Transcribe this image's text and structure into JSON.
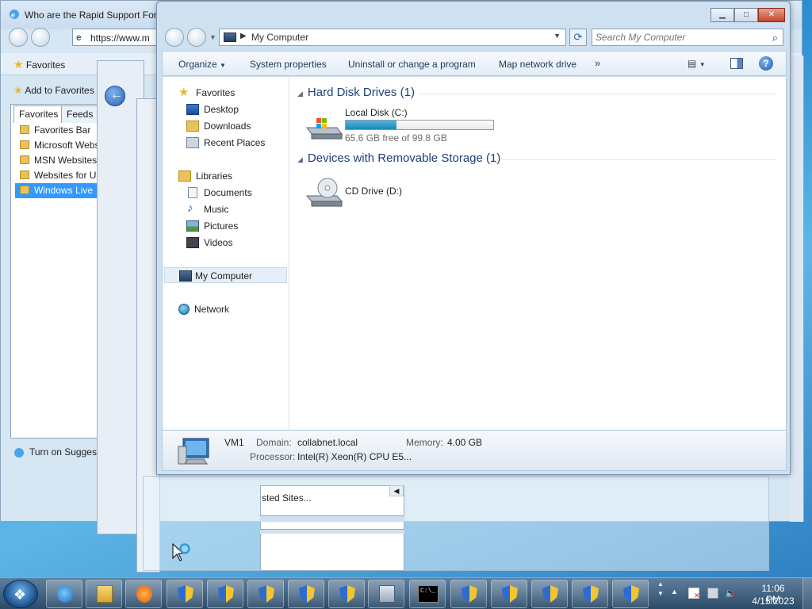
{
  "ie": {
    "title": "Who are the Rapid Support Forc",
    "address": "https://www.m",
    "favorites_button": "Favorites",
    "add_to_favorites": "Add to Favorites",
    "tabs": [
      "Favorites",
      "Feeds"
    ],
    "favorites_items": [
      {
        "label": "Favorites Bar"
      },
      {
        "label": "Microsoft Webs"
      },
      {
        "label": "MSN Websites"
      },
      {
        "label": "Websites for Ur"
      },
      {
        "label": "Windows Live"
      }
    ],
    "suggested_link": "Turn on Sugges",
    "lower_text": "sted Sites..."
  },
  "explorer": {
    "address": "My Computer",
    "search_placeholder": "Search My Computer",
    "toolbar": {
      "organize": "Organize",
      "system_properties": "System properties",
      "uninstall": "Uninstall or change a program",
      "map_drive": "Map network drive",
      "more": "»"
    },
    "nav": {
      "favorites": "Favorites",
      "desktop": "Desktop",
      "downloads": "Downloads",
      "recent_places": "Recent Places",
      "libraries": "Libraries",
      "documents": "Documents",
      "music": "Music",
      "pictures": "Pictures",
      "videos": "Videos",
      "my_computer": "My Computer",
      "network": "Network"
    },
    "groups": {
      "hdd": "Hard Disk Drives (1)",
      "removable": "Devices with Removable Storage (1)"
    },
    "drive_c": {
      "label": "Local Disk (C:)",
      "free_text": "65.6 GB free of 99.8 GB",
      "used_fraction": 0.343
    },
    "drive_d": {
      "label": "CD Drive (D:)"
    },
    "details": {
      "name": "VM1",
      "domain_label": "Domain:",
      "domain": "collabnet.local",
      "memory_label": "Memory:",
      "memory": "4.00 GB",
      "processor_label": "Processor:",
      "processor": "Intel(R) Xeon(R) CPU E5..."
    }
  },
  "taskbar": {
    "time": "11:06 PM",
    "date": "4/15/2023",
    "buttons": [
      "ie-icon",
      "explorer-icon",
      "media-player-icon",
      "uac-shield-icon",
      "uac-shield-icon",
      "uac-shield-icon",
      "uac-shield-icon",
      "uac-shield-icon",
      "calculator-icon",
      "cmd-icon",
      "uac-shield-icon",
      "uac-shield-icon",
      "uac-shield-icon",
      "uac-shield-icon",
      "uac-shield-icon"
    ],
    "cmd_text": "C:\\_"
  }
}
